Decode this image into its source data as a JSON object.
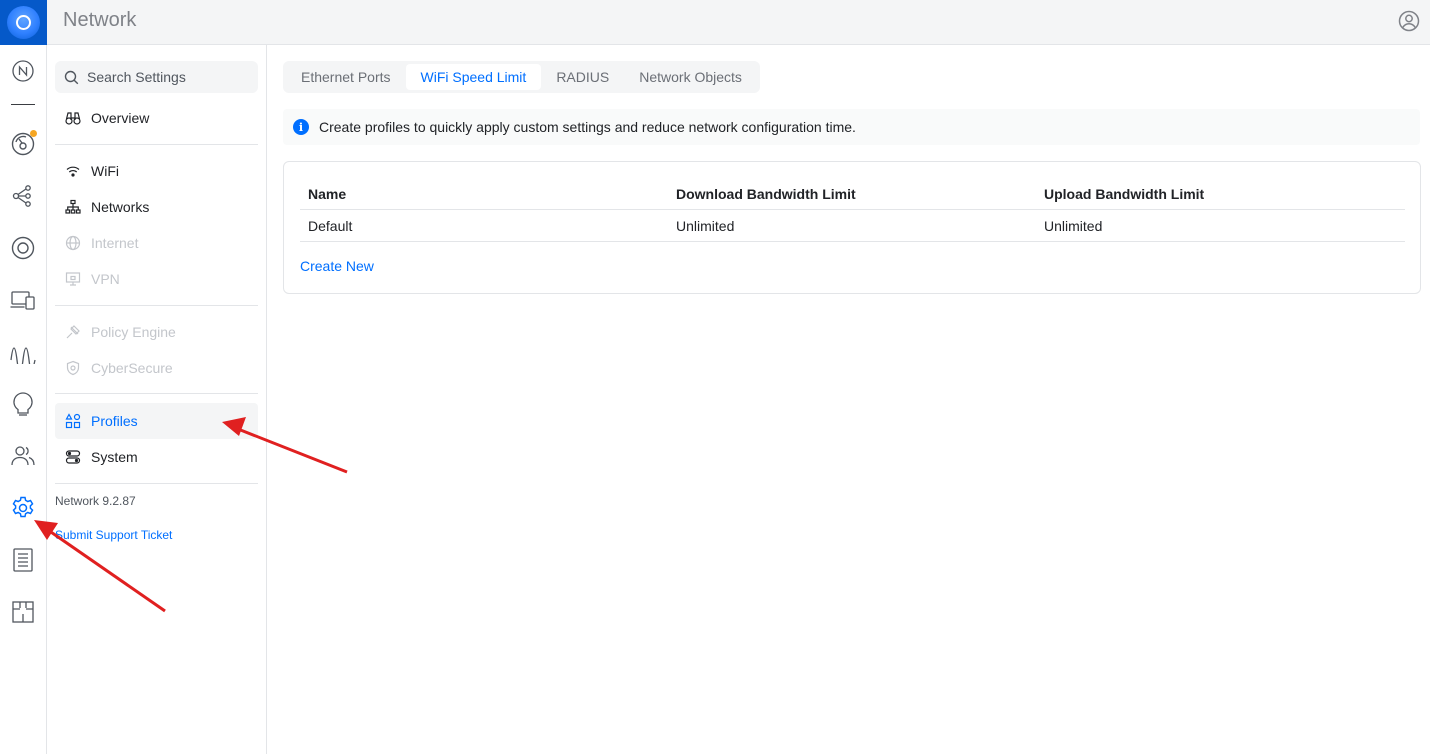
{
  "app": {
    "title": "Network"
  },
  "topbar": {
    "account_icon": "user-circle-icon"
  },
  "rail": {
    "items": [
      {
        "name": "network-logo-icon",
        "active": false
      },
      {
        "name": "dashboard-icon",
        "notification": true
      },
      {
        "name": "topology-icon"
      },
      {
        "name": "unifi-devices-icon"
      },
      {
        "name": "client-devices-icon"
      },
      {
        "name": "statistics-icon"
      },
      {
        "name": "insights-icon"
      },
      {
        "name": "users-icon"
      },
      {
        "name": "settings-icon",
        "active": true
      },
      {
        "name": "logs-icon"
      },
      {
        "name": "floorplan-icon"
      }
    ]
  },
  "sidebar": {
    "search_placeholder": "Search Settings",
    "items": [
      {
        "label": "Overview",
        "icon": "binoculars-icon",
        "state": "normal"
      },
      {
        "label": "WiFi",
        "icon": "wifi-icon",
        "state": "normal"
      },
      {
        "label": "Networks",
        "icon": "network-tree-icon",
        "state": "normal"
      },
      {
        "label": "Internet",
        "icon": "globe-icon",
        "state": "disabled"
      },
      {
        "label": "VPN",
        "icon": "vpn-monitor-icon",
        "state": "disabled"
      },
      {
        "label": "Policy Engine",
        "icon": "policy-icon",
        "state": "disabled"
      },
      {
        "label": "CyberSecure",
        "icon": "shield-icon",
        "state": "disabled"
      },
      {
        "label": "Profiles",
        "icon": "profiles-grid-icon",
        "state": "active"
      },
      {
        "label": "System",
        "icon": "system-toggle-icon",
        "state": "normal"
      }
    ],
    "version": "Network 9.2.87",
    "support_link": "Submit Support Ticket"
  },
  "tabs": [
    {
      "label": "Ethernet Ports",
      "active": false
    },
    {
      "label": "WiFi Speed Limit",
      "active": true
    },
    {
      "label": "RADIUS",
      "active": false
    },
    {
      "label": "Network Objects",
      "active": false
    }
  ],
  "banner": {
    "icon": "info-icon",
    "text": "Create profiles to quickly apply custom settings and reduce network configuration time."
  },
  "table": {
    "columns": [
      "Name",
      "Download Bandwidth Limit",
      "Upload Bandwidth Limit"
    ],
    "rows": [
      [
        "Default",
        "Unlimited",
        "Unlimited"
      ]
    ]
  },
  "create_new": "Create New",
  "colors": {
    "accent": "#006fff",
    "brand": "#0559c9",
    "notification": "#f5a623",
    "annotation_arrow": "#e02020"
  }
}
